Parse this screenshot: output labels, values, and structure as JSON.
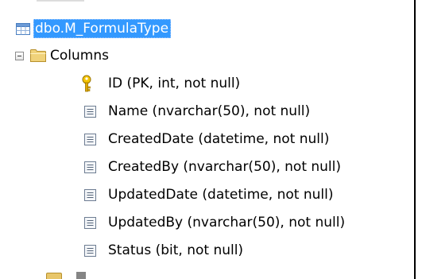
{
  "tree": {
    "table": {
      "label": "dbo.M_FormulaType",
      "icon": "table-icon"
    },
    "columns_folder": {
      "label": "Columns",
      "icon": "folder-icon",
      "expander": "collapse"
    },
    "columns": [
      {
        "label": "ID (PK, int, not null)",
        "icon": "key-icon"
      },
      {
        "label": "Name (nvarchar(50), not null)",
        "icon": "column-icon"
      },
      {
        "label": "CreatedDate (datetime, not null)",
        "icon": "column-icon"
      },
      {
        "label": "CreatedBy (nvarchar(50), not null)",
        "icon": "column-icon"
      },
      {
        "label": "UpdatedDate (datetime, not null)",
        "icon": "column-icon"
      },
      {
        "label": "UpdatedBy (nvarchar(50), not null)",
        "icon": "column-icon"
      },
      {
        "label": "Status (bit, not null)",
        "icon": "column-icon"
      }
    ]
  },
  "colors": {
    "selection": "#3399ff",
    "selection_text": "#ffffff",
    "folder": "#e8c66a",
    "key": "#e0a800"
  }
}
